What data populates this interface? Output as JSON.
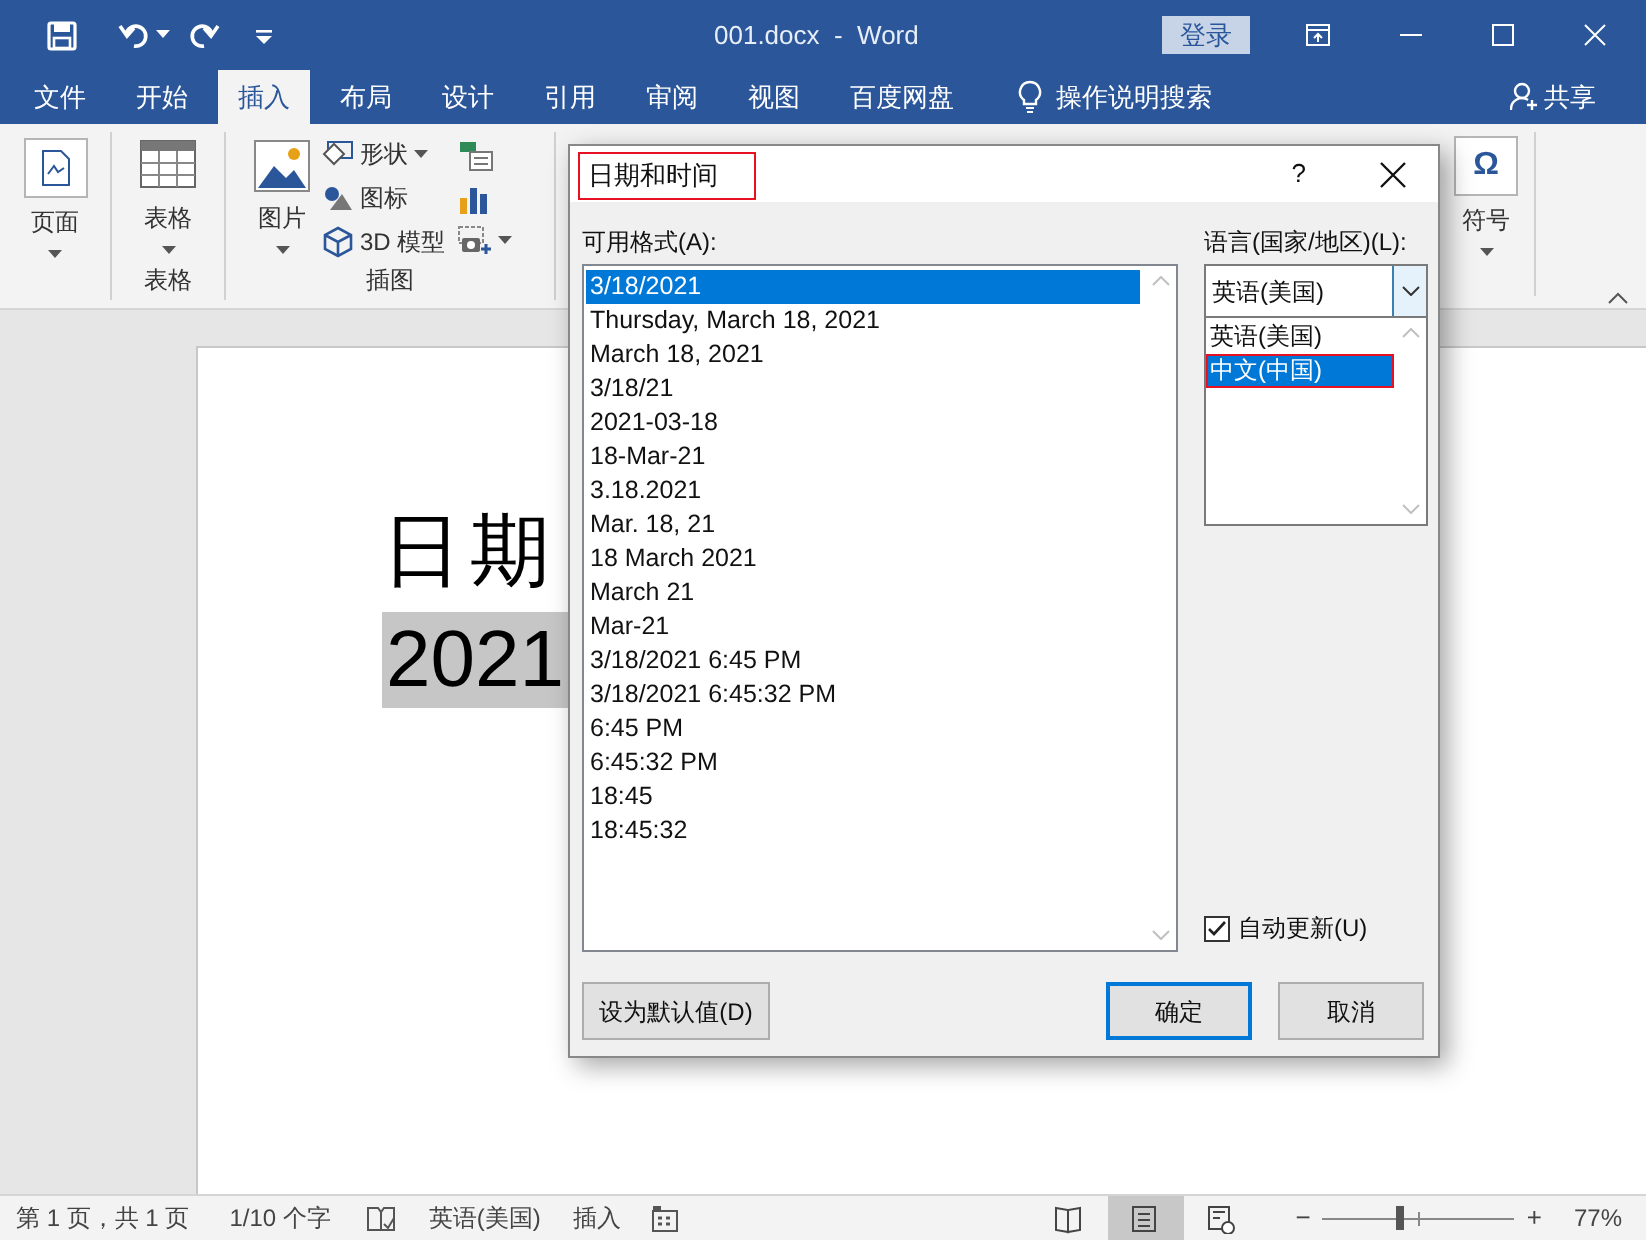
{
  "title_bar": {
    "title": "001.docx  -  Word",
    "sign_in": "登录"
  },
  "tabs": [
    {
      "label": "文件",
      "selected": false
    },
    {
      "label": "开始",
      "selected": false
    },
    {
      "label": "插入",
      "selected": true
    },
    {
      "label": "布局",
      "selected": false
    },
    {
      "label": "设计",
      "selected": false
    },
    {
      "label": "引用",
      "selected": false
    },
    {
      "label": "审阅",
      "selected": false
    },
    {
      "label": "视图",
      "selected": false
    },
    {
      "label": "百度网盘",
      "selected": false
    }
  ],
  "tell_me": "操作说明搜索",
  "share": "共享",
  "ribbon": {
    "pages_button": "页面",
    "table_button": "表格",
    "table_group": "表格",
    "picture_button": "图片",
    "shapes_button": "形状",
    "icons_button": "图标",
    "models_button": "3D 模型",
    "illustrations_group": "插图",
    "symbol_button": "符号",
    "symbol_glyph": "Ω"
  },
  "document": {
    "heading": "日期",
    "selected_text": "2021"
  },
  "dialog": {
    "title": "日期和时间",
    "title_annotated": true,
    "help": "?",
    "formats_label": "可用格式(A):",
    "formats": [
      {
        "text": "3/18/2021",
        "selected": true
      },
      {
        "text": "Thursday, March 18, 2021",
        "selected": false
      },
      {
        "text": "March 18, 2021",
        "selected": false
      },
      {
        "text": "3/18/21",
        "selected": false
      },
      {
        "text": "2021-03-18",
        "selected": false
      },
      {
        "text": "18-Mar-21",
        "selected": false
      },
      {
        "text": "3.18.2021",
        "selected": false
      },
      {
        "text": "Mar. 18, 21",
        "selected": false
      },
      {
        "text": "18 March 2021",
        "selected": false
      },
      {
        "text": "March 21",
        "selected": false
      },
      {
        "text": "Mar-21",
        "selected": false
      },
      {
        "text": "3/18/2021 6:45 PM",
        "selected": false
      },
      {
        "text": "3/18/2021 6:45:32 PM",
        "selected": false
      },
      {
        "text": "6:45 PM",
        "selected": false
      },
      {
        "text": "6:45:32 PM",
        "selected": false
      },
      {
        "text": "18:45",
        "selected": false
      },
      {
        "text": "18:45:32",
        "selected": false
      }
    ],
    "language_label": "语言(国家/地区)(L):",
    "language_value": "英语(美国)",
    "language_options": [
      {
        "text": "英语(美国)",
        "selected": false,
        "annotated": false
      },
      {
        "text": "中文(中国)",
        "selected": true,
        "annotated": true
      }
    ],
    "auto_update": {
      "label": "自动更新(U)",
      "checked": true
    },
    "buttons": [
      {
        "label": "设为默认值(D)",
        "focused": false
      },
      {
        "label": "确定",
        "focused": true
      },
      {
        "label": "取消",
        "focused": false
      }
    ]
  },
  "status_bar": {
    "page": "第 1 页，共 1 页",
    "words": "1/10 个字",
    "language": "英语(美国)",
    "mode": "插入",
    "views": [
      {
        "kind": "read",
        "selected": false
      },
      {
        "kind": "print",
        "selected": true
      },
      {
        "kind": "web",
        "selected": false
      }
    ],
    "zoom": {
      "minus": "−",
      "plus": "+",
      "level": 0.4,
      "reading": "77%"
    }
  }
}
